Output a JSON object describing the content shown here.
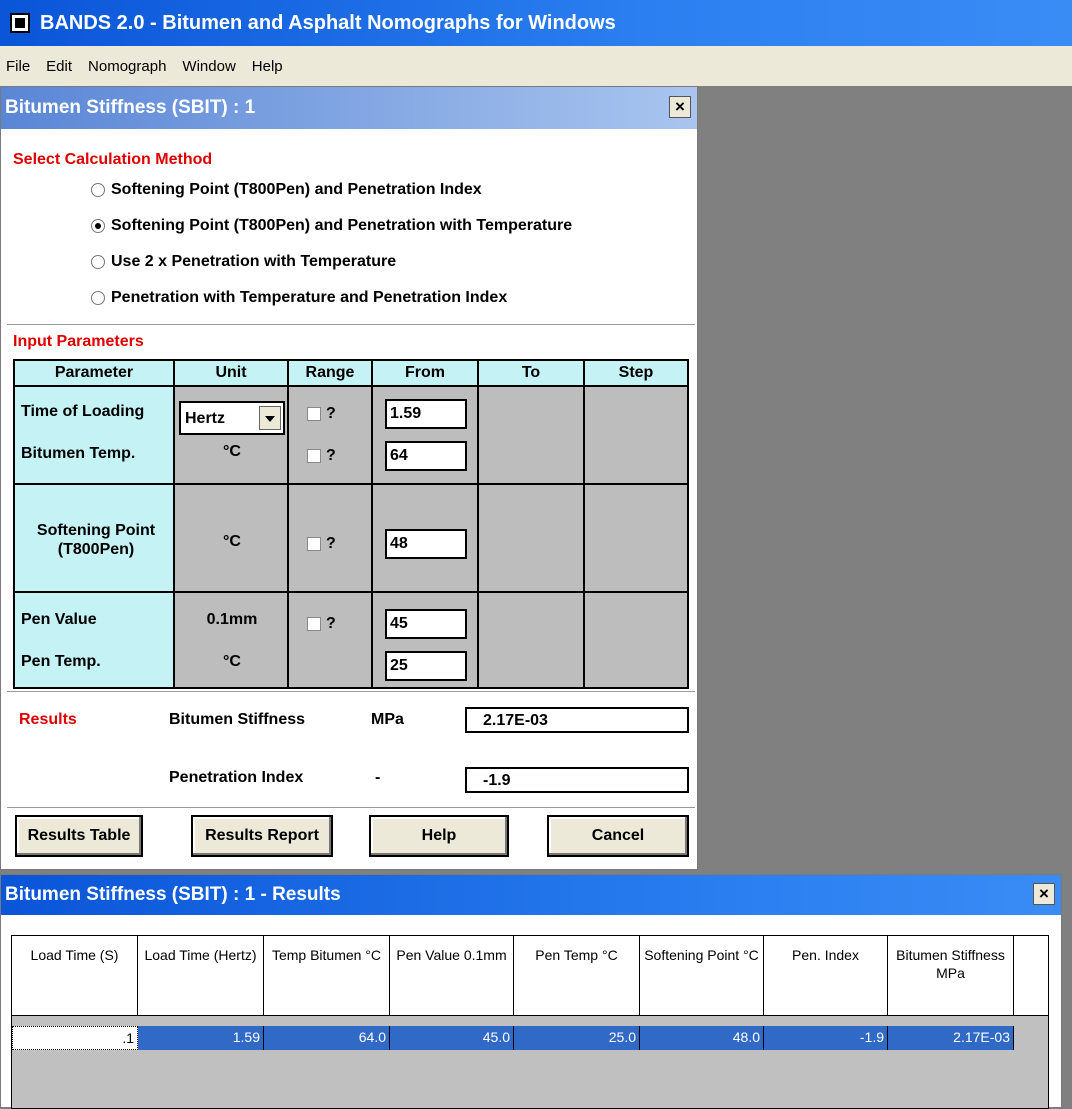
{
  "app": {
    "title": "BANDS 2.0 - Bitumen and Asphalt Nomographs for Windows",
    "menu": [
      "File",
      "Edit",
      "Nomograph",
      "Window",
      "Help"
    ]
  },
  "dialog": {
    "title": "Bitumen Stiffness (SBIT) : 1",
    "close": "×",
    "method_label": "Select Calculation Method",
    "methods": [
      {
        "label": "Softening Point (T800Pen) and Penetration Index",
        "checked": false
      },
      {
        "label": "Softening Point (T800Pen) and Penetration with Temperature",
        "checked": true
      },
      {
        "label": "Use 2 x Penetration with Temperature",
        "checked": false
      },
      {
        "label": "Penetration with Temperature and Penetration Index",
        "checked": false
      }
    ],
    "input_label": "Input Parameters",
    "headers": [
      "Parameter",
      "Unit",
      "Range",
      "From",
      "To",
      "Step"
    ],
    "params": {
      "time_of_loading": {
        "label": "Time of Loading",
        "unit": "Hertz",
        "range_q": "?",
        "from": "1.59"
      },
      "bitumen_temp": {
        "label": "Bitumen Temp.",
        "unit": "°C",
        "range_q": "?",
        "from": "64"
      },
      "softening_point": {
        "label": "Softening Point (T800Pen)",
        "unit": "°C",
        "range_q": "?",
        "from": "48"
      },
      "pen_value": {
        "label": "Pen Value",
        "unit": "0.1mm",
        "range_q": "?",
        "from": "45"
      },
      "pen_temp": {
        "label": "Pen Temp.",
        "unit": "°C",
        "from": "25"
      }
    },
    "results": {
      "label": "Results",
      "stiffness_label": "Bitumen Stiffness",
      "stiffness_unit": "MPa",
      "stiffness_value": "2.17E-03",
      "pi_label": "Penetration Index",
      "pi_unit": "-",
      "pi_value": "-1.9"
    },
    "buttons": {
      "results_table": "Results Table",
      "results_report": "Results Report",
      "help": "Help",
      "cancel": "Cancel"
    }
  },
  "results_window": {
    "title": "Bitumen Stiffness (SBIT) : 1 - Results",
    "close": "×",
    "headers": [
      "Load Time (S)",
      "Load Time (Hertz)",
      "Temp Bitumen °C",
      "Pen Value 0.1mm",
      "Pen Temp °C",
      "Softening Point °C",
      "Pen. Index",
      "Bitumen Stiffness MPa"
    ],
    "row": [
      ".1",
      "1.59",
      "64.0",
      "45.0",
      "25.0",
      "48.0",
      "-1.9",
      "2.17E-03"
    ]
  }
}
